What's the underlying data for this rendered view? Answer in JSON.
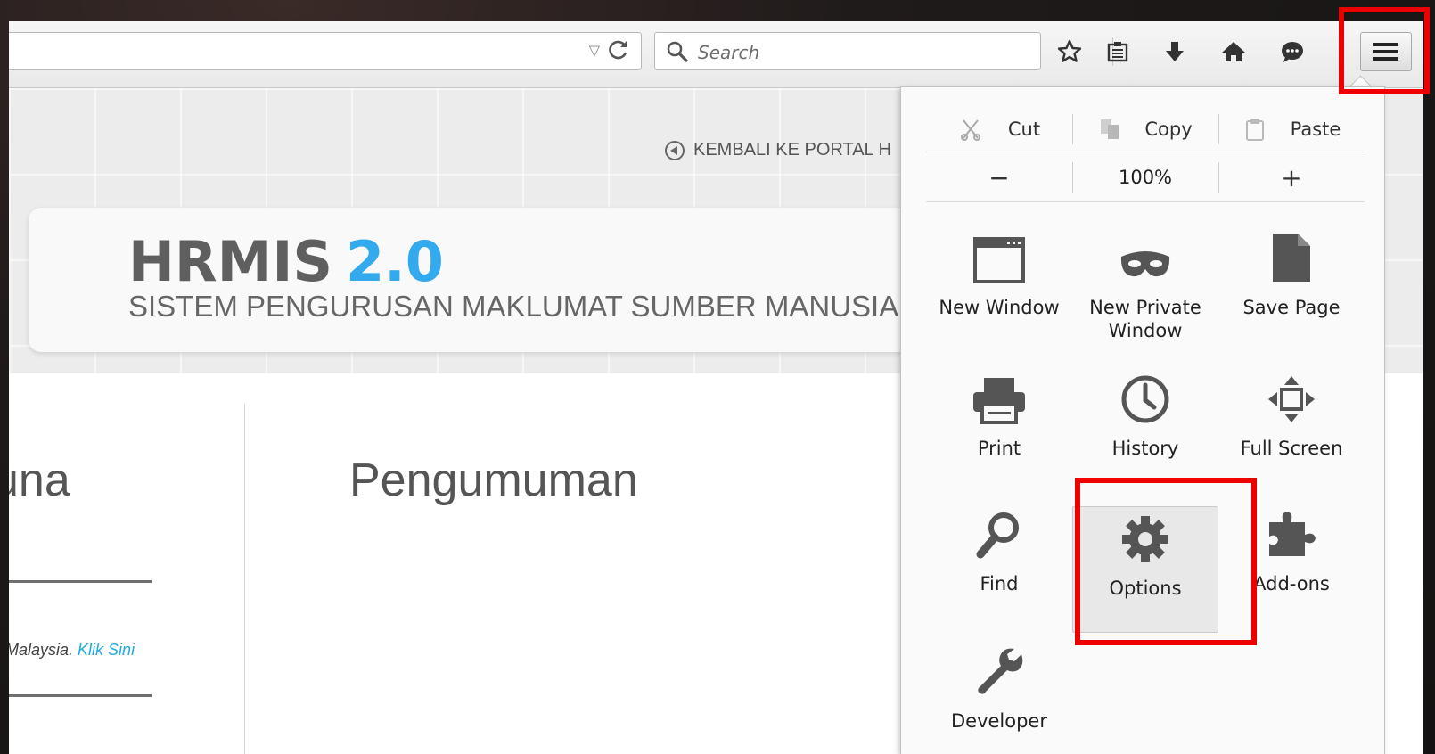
{
  "toolbar": {
    "search_placeholder": "Search",
    "icons": [
      "star-icon",
      "reading-list-icon",
      "download-icon",
      "home-icon",
      "chat-icon",
      "hamburger-menu-icon"
    ]
  },
  "page": {
    "back_link": "KEMBALI KE PORTAL H",
    "logo_text_gray": "HRMIS",
    "logo_text_blue": "2.0",
    "logo_subtitle": "SISTEM PENGURUSAN MAKLUMAT SUMBER MANUSIA",
    "login_heading_partial": "una",
    "announcement_heading": "Pengumuman",
    "notice_text": "Malaysia.",
    "notice_link": "Klik Sini"
  },
  "menu": {
    "edit": {
      "cut": "Cut",
      "copy": "Copy",
      "paste": "Paste"
    },
    "zoom": {
      "minus": "−",
      "level": "100%",
      "plus": "+"
    },
    "items": [
      {
        "label": "New Window",
        "icon": "new-window-icon"
      },
      {
        "label": "New Private\nWindow",
        "icon": "private-mask-icon"
      },
      {
        "label": "Save Page",
        "icon": "save-page-icon"
      },
      {
        "label": "Print",
        "icon": "printer-icon"
      },
      {
        "label": "History",
        "icon": "clock-icon"
      },
      {
        "label": "Full Screen",
        "icon": "fullscreen-icon"
      },
      {
        "label": "Find",
        "icon": "magnifier-icon"
      },
      {
        "label": "Options",
        "icon": "gear-icon"
      },
      {
        "label": "Add-ons",
        "icon": "puzzle-icon"
      },
      {
        "label": "Developer",
        "icon": "wrench-icon"
      }
    ]
  },
  "colors": {
    "highlight_red": "#ee0000",
    "logo_blue": "#33aaee",
    "link_blue": "#22aadd"
  }
}
